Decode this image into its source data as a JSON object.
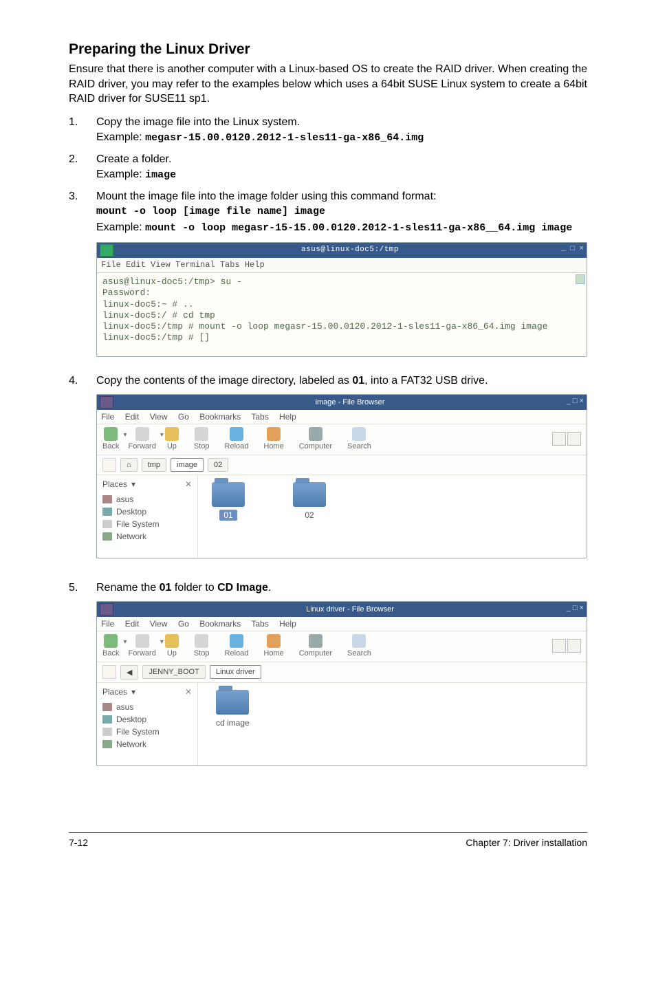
{
  "title": "Preparing the Linux Driver",
  "intro": "Ensure that there is another computer with a Linux-based OS to create the RAID driver. When creating the RAID driver, you may refer to the examples below which uses a 64bit SUSE Linux system to create a 64bit RAID driver for SUSE11 sp1.",
  "steps": {
    "s1": {
      "num": "1.",
      "text": "Copy the image file into the Linux system.",
      "example_label": "Example: ",
      "example_code": "megasr-15.00.0120.2012-1-sles11-ga-x86_64.img"
    },
    "s2": {
      "num": "2.",
      "text": "Create a folder.",
      "example_label": "Example: ",
      "example_code": "image"
    },
    "s3": {
      "num": "3.",
      "text": "Mount the image file into the image folder using this command format:",
      "cmd": "mount -o loop [image file name] image",
      "example_label": "Example: ",
      "example_code": "mount -o loop megasr-15-15.00.0120.2012-1-sles11-ga-x86__64.img image"
    },
    "s4": {
      "num": "4.",
      "text_pre": "Copy the contents of the image directory, labeled as ",
      "text_bold": "01",
      "text_post": ", into  a FAT32 USB drive."
    },
    "s5": {
      "num": "5.",
      "text_pre": "Rename the ",
      "text_bold1": "01",
      "text_mid": " folder to ",
      "text_bold2": "CD Image",
      "text_post": "."
    }
  },
  "terminal": {
    "title": "asus@linux-doc5:/tmp",
    "menubar": "File  Edit  View  Terminal  Tabs  Help",
    "lines": [
      "asus@linux-doc5:/tmp> su -",
      "Password:",
      "linux-doc5:~ # ..",
      "linux-doc5:/ # cd tmp",
      "linux-doc5:/tmp # mount -o loop megasr-15.00.0120.2012-1-sles11-ga-x86_64.img image",
      "linux-doc5:/tmp # []"
    ]
  },
  "fb_common": {
    "menubar": {
      "file": "File",
      "edit": "Edit",
      "view": "View",
      "go": "Go",
      "bookmarks": "Bookmarks",
      "tabs": "Tabs",
      "help": "Help"
    },
    "toolbar": {
      "back": "Back",
      "forward": "Forward",
      "up": "Up",
      "stop": "Stop",
      "reload": "Reload",
      "home": "Home",
      "computer": "Computer",
      "search": "Search"
    },
    "places": {
      "header": "Places",
      "asus": "asus",
      "desktop": "Desktop",
      "filesystem": "File System",
      "network": "Network"
    }
  },
  "fb1": {
    "title": "image - File Browser",
    "path": {
      "tmp": "tmp",
      "image": "image",
      "sub": "02"
    },
    "items": {
      "a": "01",
      "b": "02"
    }
  },
  "fb2": {
    "title": "Linux driver - File Browser",
    "path": {
      "root": "JENNY_BOOT",
      "cur": "Linux driver"
    },
    "items": {
      "a": "cd image"
    }
  },
  "footer": {
    "left": "7-12",
    "right": "Chapter 7: Driver installation"
  }
}
